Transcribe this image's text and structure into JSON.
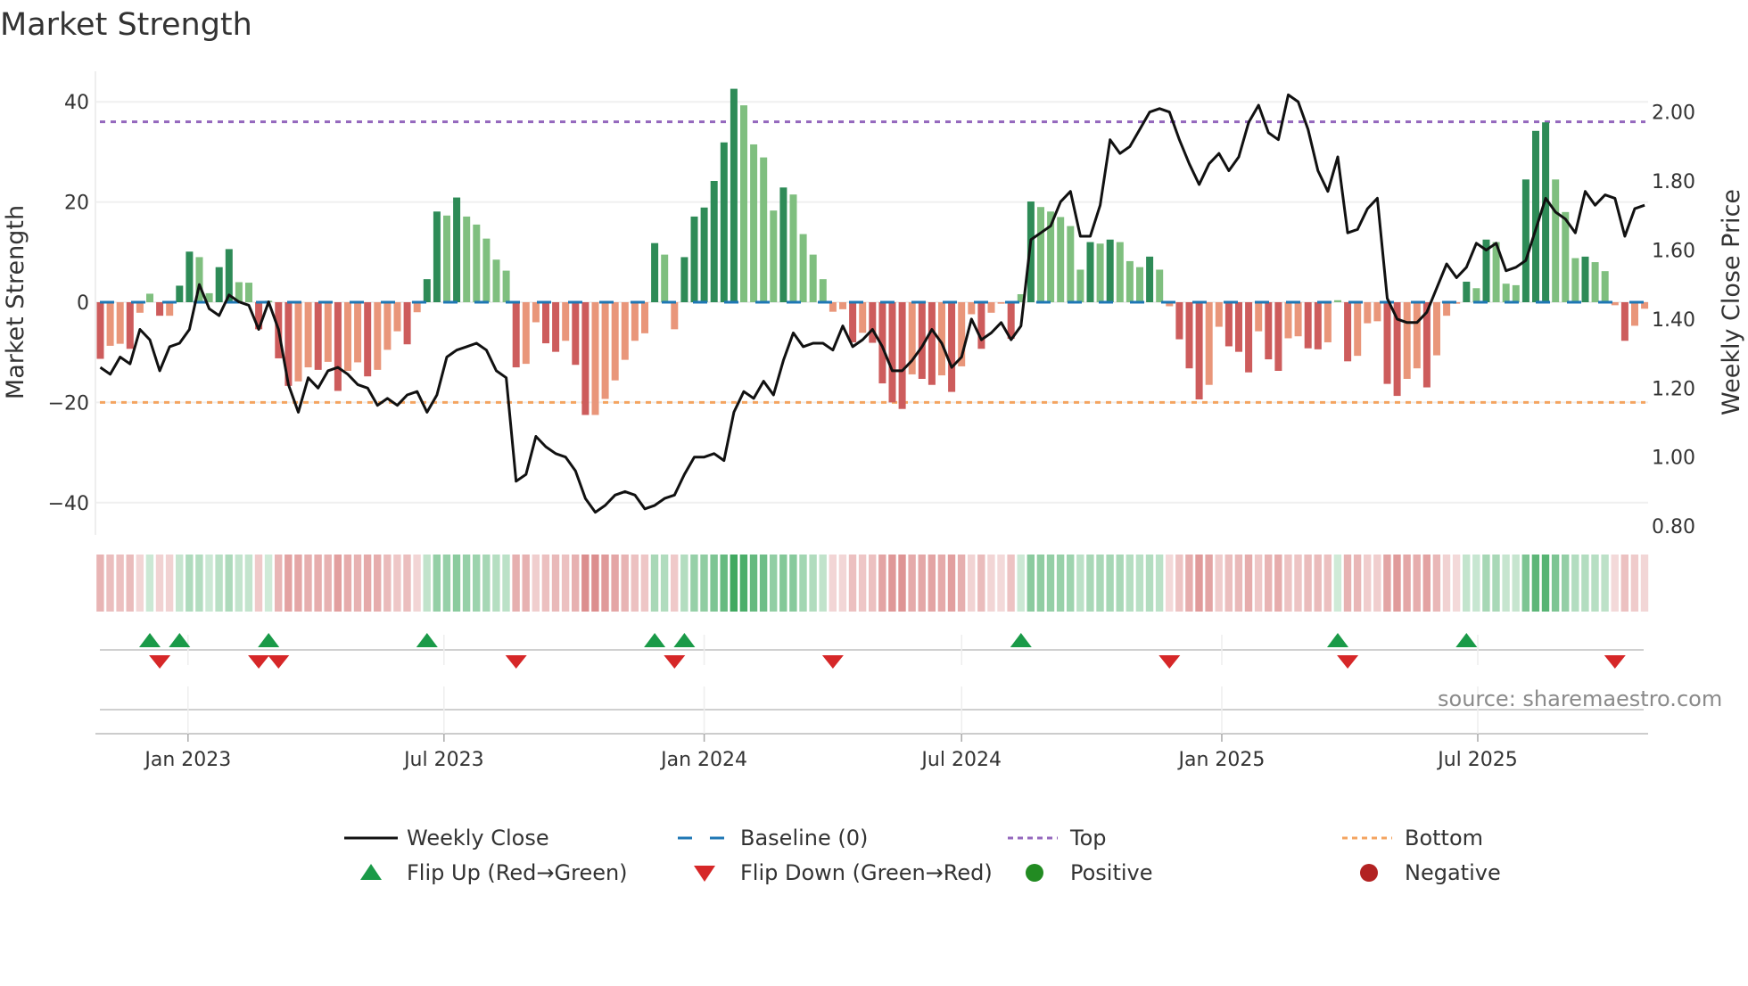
{
  "title": "Market Strength",
  "source": "source: sharemaestro.com",
  "colors": {
    "bar_pos_strong": "#2e8b57",
    "bar_pos_weak": "#7fbf7f",
    "bar_neg_strong": "#cd5c5c",
    "bar_neg_weak": "#e9967a",
    "price_line": "#111111",
    "baseline": "#1f77b4",
    "top_line": "#9467bd",
    "bottom_line": "#f4a460",
    "flip_up": "#1a9a48",
    "flip_down": "#d62728",
    "positive": "#228b22",
    "negative": "#b22222"
  },
  "chart_data": {
    "type": "bar",
    "title": "Market Strength",
    "frequency": "weekly",
    "x_start": "2022-10-31",
    "xlabel": "",
    "ylabel": "Market Strength",
    "y2label": "Weekly Close Price",
    "ylim": [
      -46,
      46
    ],
    "y2lim": [
      0.8,
      2.1
    ],
    "yticks": [
      40,
      20,
      0,
      -20,
      -40
    ],
    "ytick_labels": [
      "40",
      "20",
      "0",
      "−20",
      "−40"
    ],
    "y2ticks": [
      2.0,
      1.8,
      1.6,
      1.4,
      1.2,
      1.0,
      0.8
    ],
    "y2tick_labels": [
      "2.00",
      "1.80",
      "1.60",
      "1.40",
      "1.20",
      "1.00",
      "0.80"
    ],
    "xticks": [
      {
        "date": "2023-01-01",
        "label": "Jan 2023"
      },
      {
        "date": "2023-07-01",
        "label": "Jul 2023"
      },
      {
        "date": "2024-01-01",
        "label": "Jan 2024"
      },
      {
        "date": "2024-07-01",
        "label": "Jul 2024"
      },
      {
        "date": "2025-01-01",
        "label": "Jan 2025"
      },
      {
        "date": "2025-07-01",
        "label": "Jul 2025"
      }
    ],
    "grid": true,
    "reference_lines": {
      "baseline": 0,
      "top": 36,
      "bottom": -20
    },
    "strength": [
      -11.3,
      -8.7,
      -8.3,
      -9.3,
      -2.1,
      1.7,
      -2.7,
      -2.7,
      3.3,
      10.1,
      9,
      1.8,
      7,
      10.6,
      4,
      3.9,
      -5.4,
      0.3,
      -11.2,
      -16.7,
      -15.8,
      -13,
      -13.5,
      -11.9,
      -17.7,
      -13.7,
      -12,
      -14.8,
      -13.5,
      -9.5,
      -5.8,
      -8.4,
      -2,
      4.6,
      18.1,
      17.3,
      20.9,
      17.1,
      15.5,
      12.7,
      8.5,
      6.3,
      -13,
      -12.3,
      -4,
      -8.2,
      -9.9,
      -7.7,
      -12.5,
      -22.5,
      -22.5,
      -19.3,
      -15.6,
      -11.5,
      -7.7,
      -6.2,
      11.8,
      9.5,
      -5.4,
      9,
      17.1,
      18.9,
      24.2,
      31.9,
      42.6,
      39.3,
      31.5,
      28.9,
      18.3,
      22.9,
      21.5,
      13.6,
      9.5,
      4.6,
      -1.9,
      -1.4,
      -8,
      -6.1,
      -8.1,
      -16.2,
      -20,
      -21.3,
      -14.4,
      -15.3,
      -16.5,
      -14.6,
      -17.9,
      -12.8,
      -2.4,
      -9.3,
      -2.1,
      -0.3,
      -7.3,
      1.6,
      20.1,
      19,
      18.1,
      17,
      15.2,
      6.5,
      12,
      11.7,
      12.5,
      12,
      8.2,
      7,
      9.1,
      6.5,
      -0.8,
      -7.4,
      -13.2,
      -19.4,
      -16.5,
      -4.9,
      -8.8,
      -9.9,
      -14,
      -5.8,
      -11.4,
      -13.7,
      -7.2,
      -6.8,
      -9.2,
      -9.4,
      -8,
      0.4,
      -11.8,
      -10.7,
      -4.2,
      -3.8,
      -16.3,
      -18.7,
      -15.3,
      -13.2,
      -17,
      -10.6,
      -2.7,
      -0.3,
      4.1,
      2.8,
      12.5,
      12,
      3.7,
      3.4,
      24.5,
      34.2,
      35.9,
      24.5,
      18,
      8.8,
      9.1,
      8,
      6.2,
      -0.6,
      -7.7,
      -4.7,
      -1.3
    ],
    "weekly_close": [
      1.26,
      1.24,
      1.29,
      1.27,
      1.37,
      1.34,
      1.25,
      1.32,
      1.33,
      1.37,
      1.5,
      1.43,
      1.41,
      1.47,
      1.45,
      1.44,
      1.37,
      1.45,
      1.37,
      1.21,
      1.13,
      1.23,
      1.2,
      1.25,
      1.26,
      1.24,
      1.21,
      1.2,
      1.15,
      1.17,
      1.15,
      1.18,
      1.19,
      1.13,
      1.18,
      1.29,
      1.31,
      1.32,
      1.33,
      1.31,
      1.25,
      1.23,
      0.93,
      0.95,
      1.06,
      1.03,
      1.01,
      1.0,
      0.96,
      0.88,
      0.84,
      0.86,
      0.89,
      0.9,
      0.89,
      0.85,
      0.86,
      0.88,
      0.89,
      0.95,
      1.0,
      1.0,
      1.01,
      0.99,
      1.13,
      1.19,
      1.17,
      1.22,
      1.18,
      1.28,
      1.36,
      1.32,
      1.33,
      1.33,
      1.31,
      1.38,
      1.32,
      1.34,
      1.37,
      1.32,
      1.25,
      1.25,
      1.28,
      1.32,
      1.37,
      1.33,
      1.26,
      1.29,
      1.4,
      1.34,
      1.36,
      1.39,
      1.34,
      1.38,
      1.63,
      1.65,
      1.67,
      1.74,
      1.77,
      1.64,
      1.64,
      1.73,
      1.92,
      1.88,
      1.9,
      1.95,
      2.0,
      2.01,
      2.0,
      1.92,
      1.85,
      1.79,
      1.85,
      1.88,
      1.83,
      1.87,
      1.97,
      2.02,
      1.94,
      1.92,
      2.05,
      2.03,
      1.95,
      1.83,
      1.77,
      1.87,
      1.65,
      1.66,
      1.72,
      1.75,
      1.46,
      1.4,
      1.39,
      1.39,
      1.42,
      1.49,
      1.56,
      1.52,
      1.55,
      1.62,
      1.6,
      1.62,
      1.54,
      1.55,
      1.57,
      1.66,
      1.75,
      1.71,
      1.69,
      1.65,
      1.77,
      1.73,
      1.76,
      1.75,
      1.64,
      1.72,
      1.73
    ],
    "legend": {
      "placement": "bottom",
      "entries": [
        {
          "key": "weekly_close",
          "label": "Weekly Close",
          "symbol": "line"
        },
        {
          "key": "baseline",
          "label": "Baseline (0)",
          "symbol": "dash"
        },
        {
          "key": "top",
          "label": "Top",
          "symbol": "dot-purple"
        },
        {
          "key": "bottom",
          "label": "Bottom",
          "symbol": "dot-orange"
        },
        {
          "key": "flip_up",
          "label": "Flip Up (Red→Green)",
          "symbol": "triangle-up"
        },
        {
          "key": "flip_down",
          "label": "Flip Down (Green→Red)",
          "symbol": "triangle-down"
        },
        {
          "key": "positive",
          "label": "Positive",
          "symbol": "circle-green"
        },
        {
          "key": "negative",
          "label": "Negative",
          "symbol": "circle-red"
        }
      ]
    }
  }
}
